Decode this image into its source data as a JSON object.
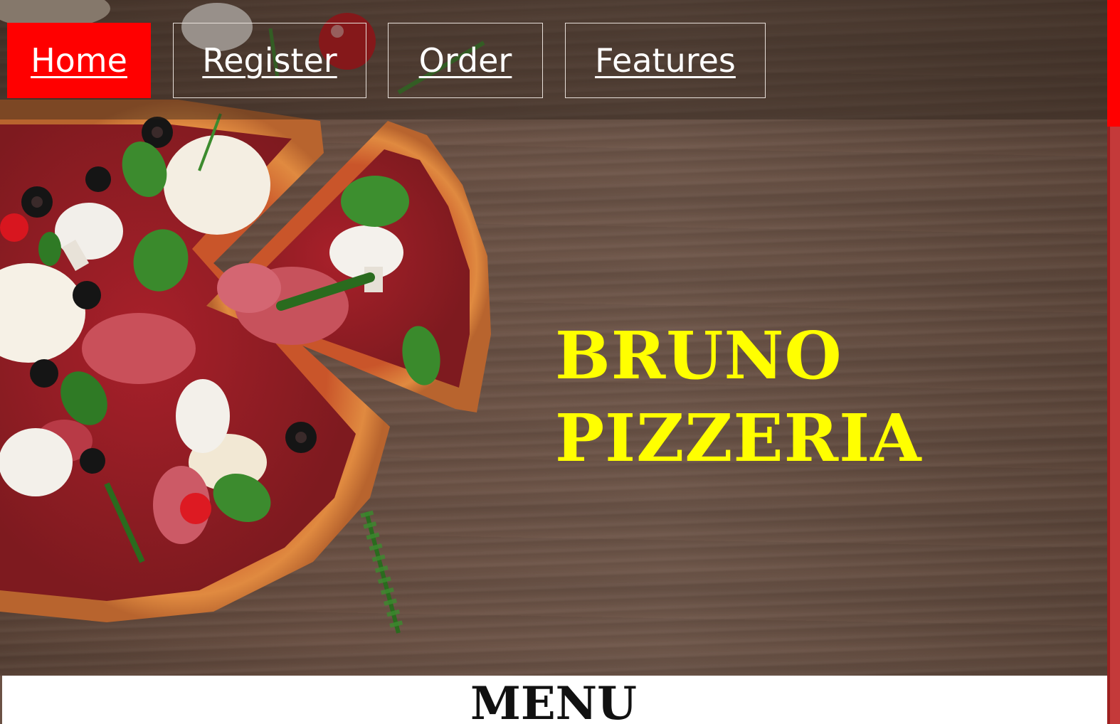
{
  "nav": {
    "items": [
      {
        "label": "Home",
        "active": true
      },
      {
        "label": "Register",
        "active": false
      },
      {
        "label": "Order",
        "active": false
      },
      {
        "label": "Features",
        "active": false
      }
    ]
  },
  "hero": {
    "brand_line1": "BRUNO",
    "brand_line2": "PIZZERIA"
  },
  "menu": {
    "heading": "MENU"
  },
  "colors": {
    "nav_active": "#ff0000",
    "brand_text": "#ffff00",
    "accent_red": "#ff0000"
  },
  "images": {
    "hero_background": "pizza-on-wooden-table"
  }
}
